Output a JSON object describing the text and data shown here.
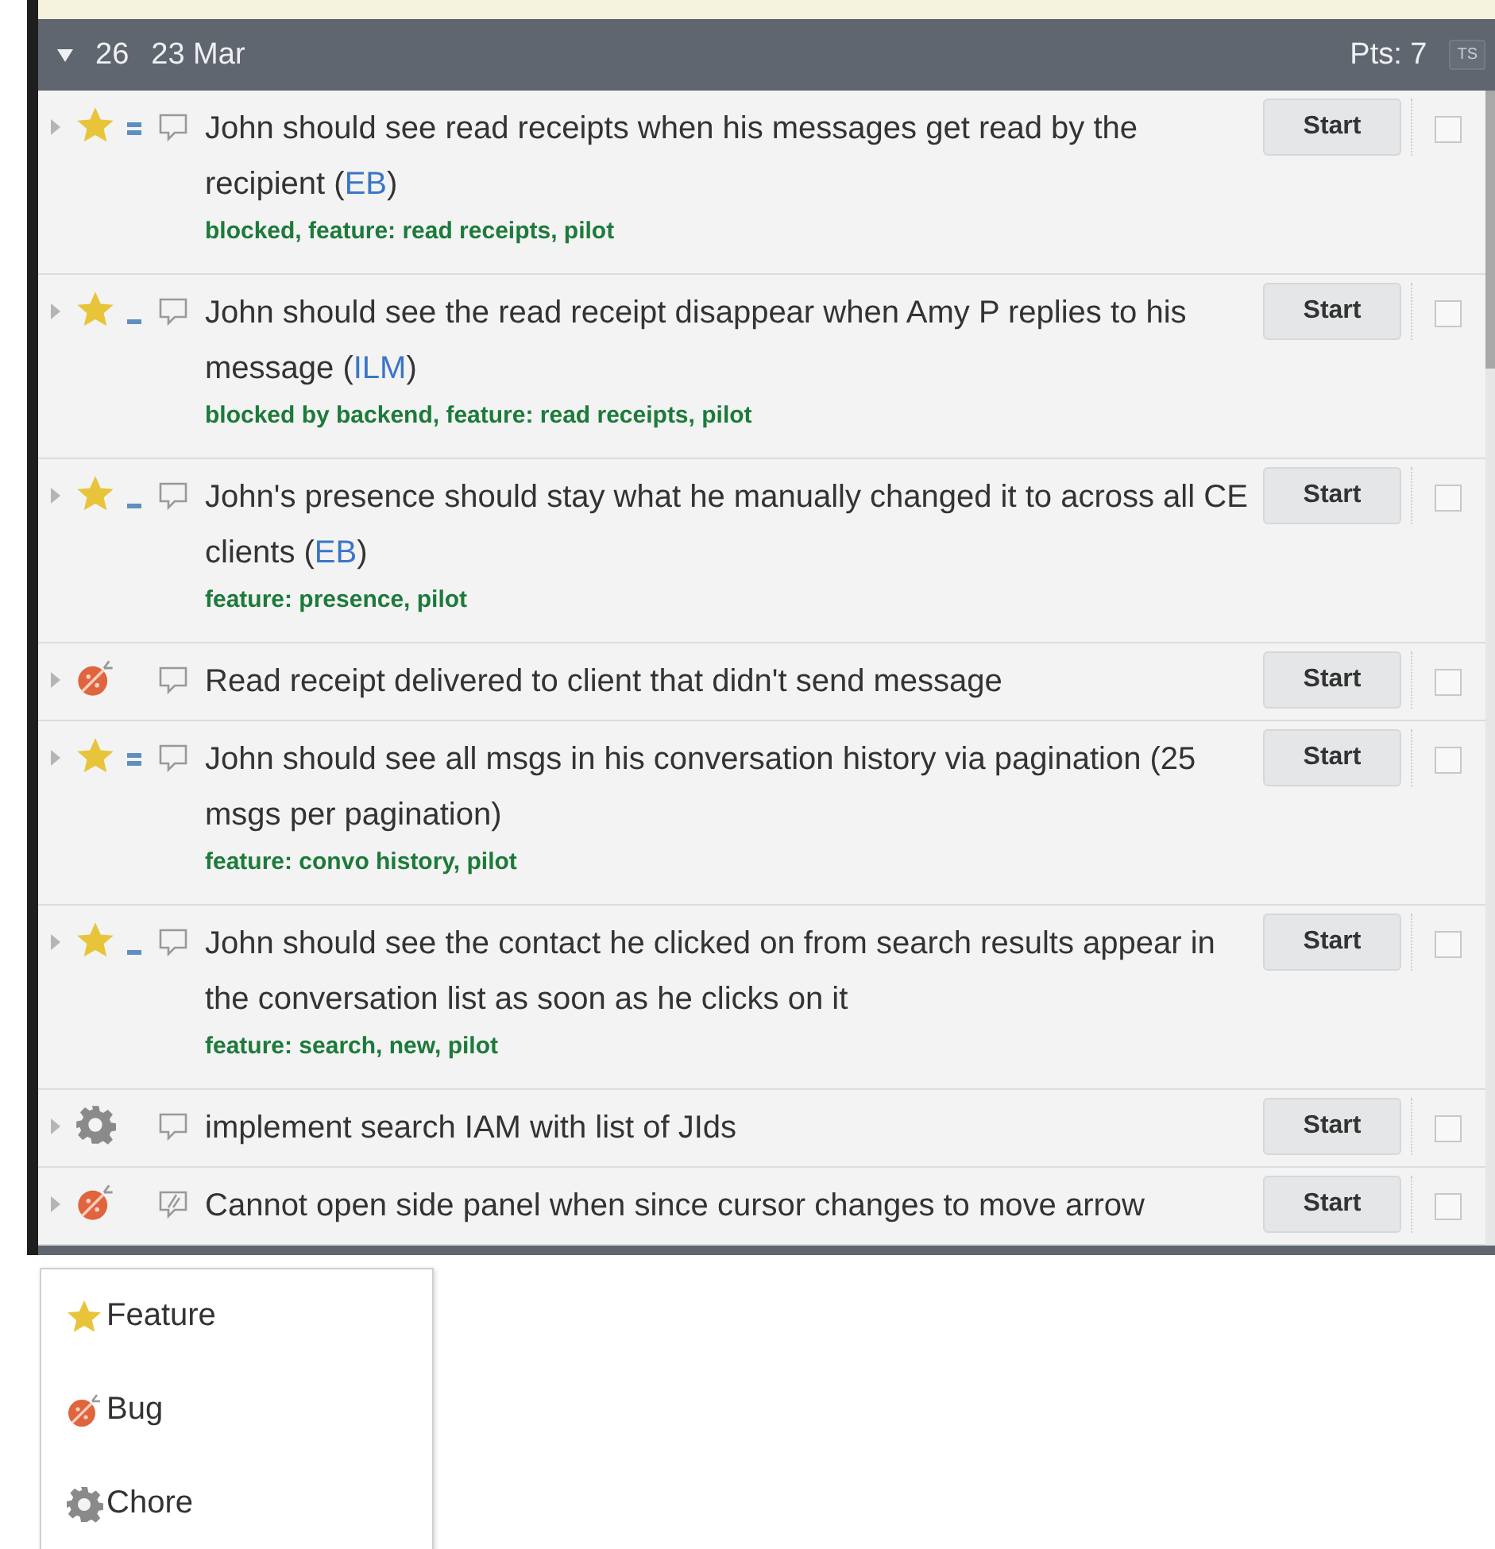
{
  "iteration": {
    "expanded": true,
    "number": "26",
    "date": "23 Mar",
    "points": "Pts: 7",
    "badge": "TS"
  },
  "stories": [
    {
      "kind": "feature",
      "estimate": {
        "kind": "double"
      },
      "note": {
        "kind": "plain"
      },
      "title_before": "John should see read receipts when his messages get read by the recipient (",
      "owner": "EB",
      "title_after": ")",
      "labels": "blocked, feature: read receipts, pilot",
      "button": "Start",
      "checked": false
    },
    {
      "kind": "feature",
      "estimate": {
        "kind": "single"
      },
      "note": {
        "kind": "plain"
      },
      "title_before": "John should see the read receipt disappear when Amy P replies to his message (",
      "owner": "ILM",
      "title_after": ")",
      "labels": "blocked by backend, feature: read receipts, pilot",
      "button": "Start",
      "checked": false
    },
    {
      "kind": "feature",
      "estimate": {
        "kind": "single"
      },
      "note": {
        "kind": "plain"
      },
      "title_before": "John's presence should stay what he manually changed it to across all CE clients (",
      "owner": "EB",
      "title_after": ")",
      "labels": "feature: presence, pilot",
      "button": "Start",
      "checked": false
    },
    {
      "kind": "bug",
      "note": {
        "kind": "plain"
      },
      "title_before": "Read receipt delivered to client that didn't send message",
      "button": "Start",
      "checked": false
    },
    {
      "kind": "feature",
      "estimate": {
        "kind": "double"
      },
      "note": {
        "kind": "plain"
      },
      "title_before": "John should see all msgs in his conversation history via pagination (25 msgs per pagination)",
      "labels": "feature: convo history, pilot",
      "button": "Start",
      "checked": false
    },
    {
      "kind": "feature",
      "estimate": {
        "kind": "single"
      },
      "note": {
        "kind": "plain"
      },
      "title_before": "John should see the contact he clicked on from search results appear in the conversation list as soon as he clicks on it",
      "labels": "feature: search, new, pilot",
      "button": "Start",
      "checked": false
    },
    {
      "kind": "chore",
      "note": {
        "kind": "plain"
      },
      "title_before": "implement search IAM with list of JIds",
      "button": "Start",
      "checked": false
    },
    {
      "kind": "bug",
      "note": {
        "kind": "attachment"
      },
      "title_before": "Cannot open side panel when since cursor changes to move arrow",
      "button": "Start",
      "checked": false
    }
  ],
  "type_menu": [
    {
      "kind": "feature",
      "label": "Feature"
    },
    {
      "kind": "bug",
      "label": "Bug"
    },
    {
      "kind": "chore",
      "label": "Chore"
    }
  ]
}
